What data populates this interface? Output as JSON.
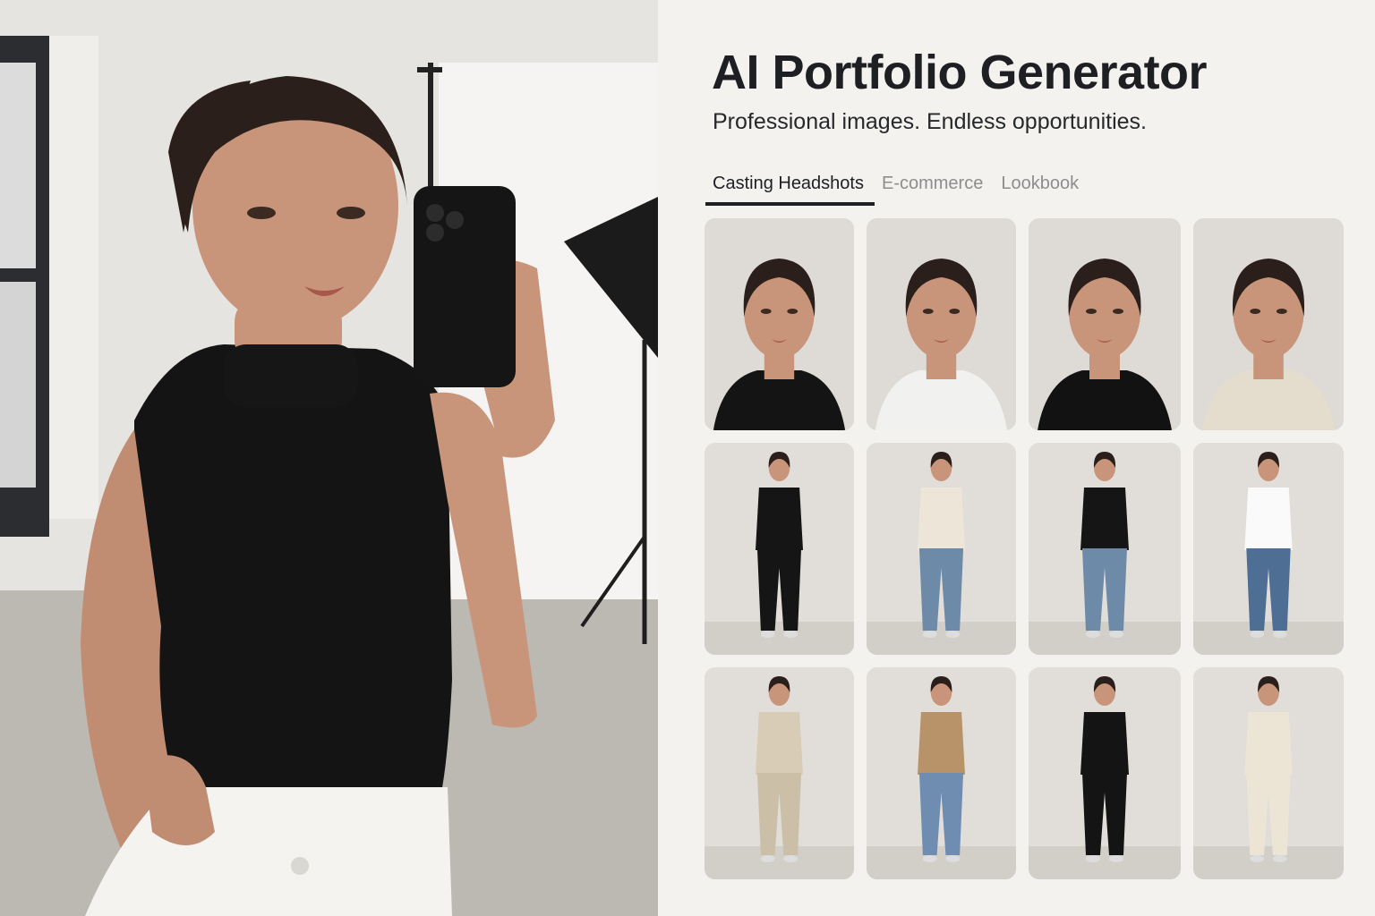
{
  "header": {
    "title": "AI Portfolio Generator",
    "subtitle": "Professional images. Endless opportunities."
  },
  "tabs": [
    {
      "label": "Casting Headshots",
      "active": true
    },
    {
      "label": "E-commerce",
      "active": false
    },
    {
      "label": "Lookbook",
      "active": false
    }
  ],
  "colors": {
    "background": "#f3f2ef",
    "title": "#1d1f22",
    "tab_inactive": "#8d8d8d",
    "tab_underline": "#1d1f22"
  },
  "gallery": {
    "rows": [
      {
        "kind": "headshot",
        "items": [
          {
            "outfit": "black sleeveless turtleneck"
          },
          {
            "outfit": "white tank top"
          },
          {
            "outfit": "black blazer"
          },
          {
            "outfit": "beige cardigan"
          }
        ]
      },
      {
        "kind": "full-body",
        "items": [
          {
            "outfit": "black sports bra and leggings"
          },
          {
            "outfit": "cream sweater and jeans"
          },
          {
            "outfit": "black hoodie and jeans"
          },
          {
            "outfit": "white t-shirt and jeans"
          }
        ]
      },
      {
        "kind": "full-body",
        "items": [
          {
            "outfit": "beige suit"
          },
          {
            "outfit": "tan jacket and jeans"
          },
          {
            "outfit": "black slip dress"
          },
          {
            "outfit": "cream long dress"
          }
        ]
      }
    ]
  }
}
